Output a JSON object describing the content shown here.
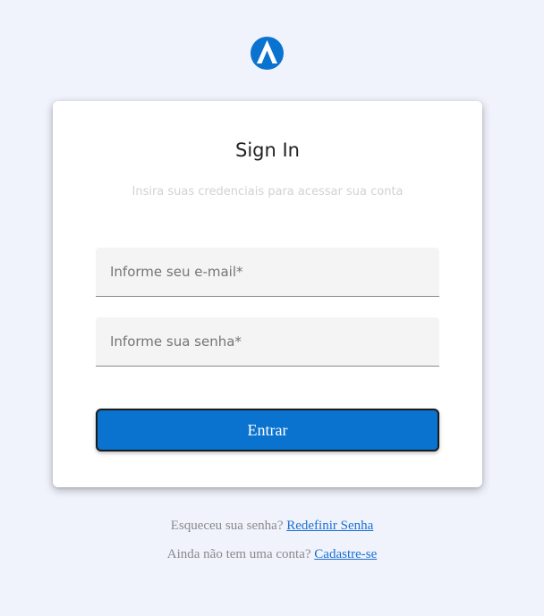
{
  "brand": {
    "logo_icon": "stylized-a-logo-icon",
    "color": "#0a73d0"
  },
  "card": {
    "title": "Sign In",
    "subtitle": "Insira suas credenciais para acessar sua conta"
  },
  "form": {
    "email_placeholder": "Informe seu e-mail*",
    "email_value": "",
    "password_placeholder": "Informe sua senha*",
    "password_value": "",
    "submit_label": "Entrar"
  },
  "footer": {
    "forgot_text": "Esqueceu sua senha?",
    "forgot_link": "Redefinir Senha",
    "signup_text": "Ainda não tem uma conta?",
    "signup_link": "Cadastre-se"
  },
  "colors": {
    "background": "#f0f3fc",
    "accent": "#0a73d0",
    "link": "#1a6fd3"
  }
}
